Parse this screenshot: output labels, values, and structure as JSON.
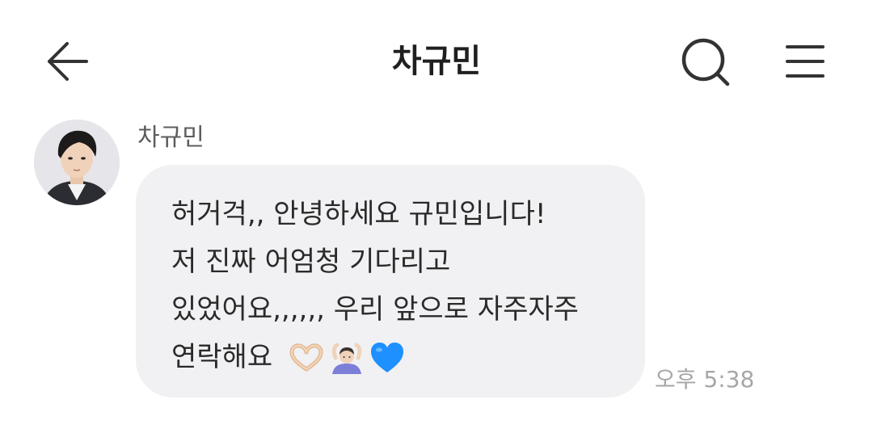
{
  "header": {
    "title": "차규민",
    "back_icon": "arrow-left-icon",
    "search_icon": "search-icon",
    "menu_icon": "hamburger-menu-icon"
  },
  "message": {
    "sender": "차규민",
    "lines": [
      "허거걱,, 안녕하세요 규민입니다!",
      "저 진짜 어엄청 기다리고",
      "있었어요,,,,,, 우리 앞으로 자주자주",
      "연락해요"
    ],
    "emojis": [
      "heart-hands-emoji",
      "person-gesturing-ok-emoji",
      "blue-heart-emoji"
    ],
    "time": "오후 5:38"
  },
  "colors": {
    "bubble": "#f1f1f3",
    "text": "#2a2a2a",
    "time": "#a6a6a6",
    "heart": "#1e90ff"
  }
}
